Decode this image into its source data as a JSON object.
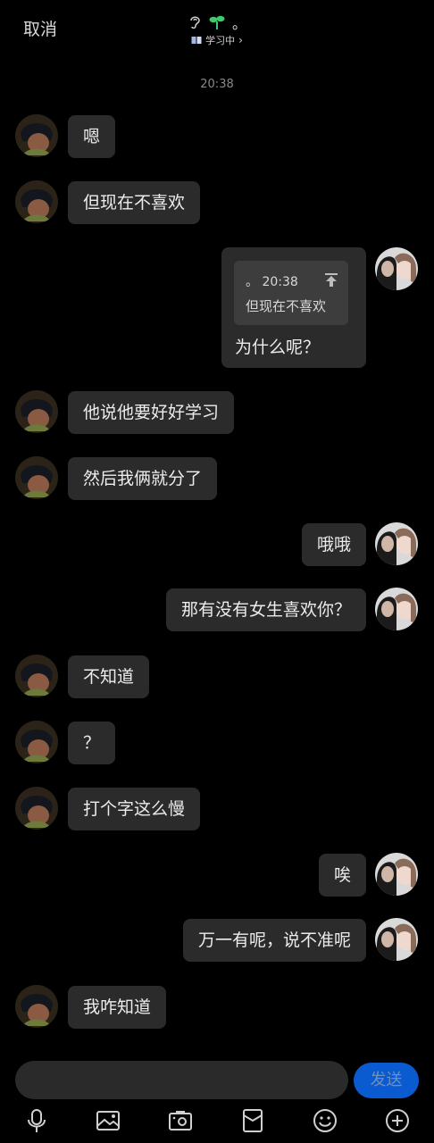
{
  "header": {
    "cancel_label": "取消",
    "title_suffix": "。",
    "status_label": "学习中",
    "status_chevron": "›"
  },
  "timestamp": "20:38",
  "messages": [
    {
      "side": "left",
      "text": "嗯"
    },
    {
      "side": "left",
      "text": "但现在不喜欢"
    },
    {
      "side": "right",
      "type": "quote",
      "quote_sender": "。",
      "quote_time": "20:38",
      "quote_text": "但现在不喜欢",
      "text": "为什么呢？"
    },
    {
      "side": "left",
      "text": "他说他要好好学习"
    },
    {
      "side": "left",
      "text": "然后我俩就分了"
    },
    {
      "side": "right",
      "text": "哦哦"
    },
    {
      "side": "right",
      "text": "那有没有女生喜欢你？"
    },
    {
      "side": "left",
      "text": "不知道"
    },
    {
      "side": "left",
      "text": "？"
    },
    {
      "side": "left",
      "text": "打个字这么慢"
    },
    {
      "side": "right",
      "text": "唉"
    },
    {
      "side": "right",
      "text": "万一有呢，说不准呢"
    },
    {
      "side": "left",
      "text": "我咋知道"
    }
  ],
  "composer": {
    "input_value": "",
    "send_label": "发送"
  },
  "toolbar_icons": [
    "microphone-icon",
    "image-icon",
    "camera-icon",
    "red-packet-icon",
    "emoji-icon",
    "plus-icon"
  ],
  "colors": {
    "background": "#000000",
    "bubble": "#2b2b2b",
    "send_button": "#0a5bd0",
    "sprout": "#3ec96a"
  }
}
